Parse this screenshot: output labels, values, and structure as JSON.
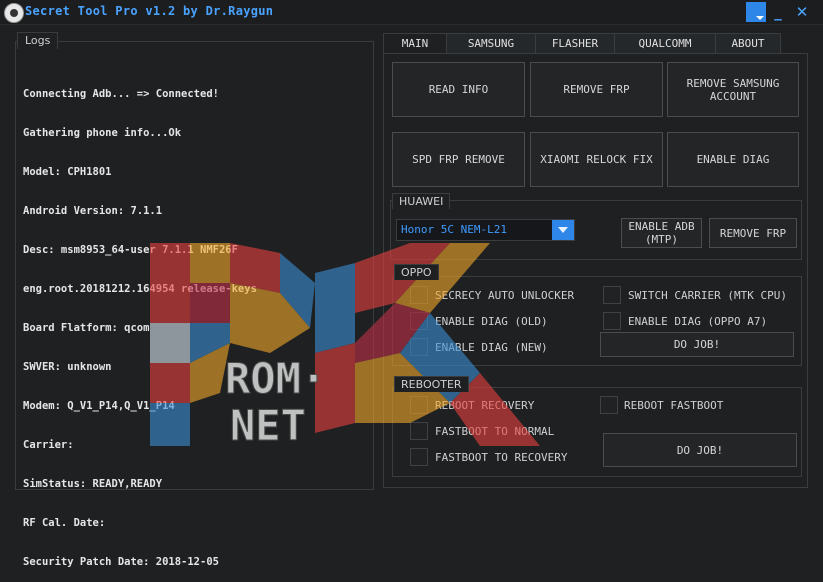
{
  "window": {
    "title": "Secret Tool Pro v1.2 by Dr.Raygun",
    "menu_icon": "dropdown-menu-icon",
    "minimize_label": "_",
    "close_label": "✕"
  },
  "logs": {
    "label": "Logs",
    "lines": [
      "Connecting Adb... => Connected!",
      "Gathering phone info...Ok",
      "Model: CPH1801",
      "Android Version: 7.1.1",
      "Desc: msm8953_64-user 7.1.1 NMF26F",
      "eng.root.20181212.164954 release-keys",
      "Board Flatform: qcom",
      "SWVER: unknown",
      "Modem: Q_V1_P14,Q_V1_P14",
      "Carrier:",
      "SimStatus: READY,READY",
      "RF Cal. Date:",
      "Security Patch Date: 2018-12-05"
    ]
  },
  "tabs": [
    "MAIN",
    "SAMSUNG",
    "FLASHER",
    "QUALCOMM",
    "ABOUT"
  ],
  "main": {
    "read_info": "READ INFO",
    "remove_frp": "REMOVE FRP",
    "remove_samsung_account": [
      "REMOVE SAMSUNG",
      "ACCOUNT"
    ],
    "spd_frp_remove": "SPD FRP REMOVE",
    "xiaomi_relock_fix": "XIAOMI RELOCK FIX",
    "enable_diag": "ENABLE DIAG"
  },
  "huawei": {
    "label": "HUAWEI",
    "model_selected": "Honor 5C NEM-L21",
    "enable_adb": [
      "ENABLE ADB",
      "(MTP)"
    ],
    "remove_frp": "REMOVE FRP"
  },
  "oppo": {
    "label": "OPPO",
    "secrecy_auto_unlocker": "SECRECY AUTO UNLOCKER",
    "switch_carrier": "SWITCH CARRIER (MTK CPU)",
    "enable_diag_old": "ENABLE DIAG (OLD)",
    "enable_diag_oppo_a7": "ENABLE DIAG (OPPO A7)",
    "enable_diag_new": "ENABLE DIAG (NEW)",
    "do_job": "DO JOB!"
  },
  "rebooter": {
    "label": "REBOOTER",
    "reboot_recovery": "REBOOT RECOVERY",
    "reboot_fastboot": "REBOOT FASTBOOT",
    "fastboot_to_normal": "FASTBOOT TO NORMAL",
    "fastboot_to_recovery": "FASTBOOT TO RECOVERY",
    "do_job": "DO JOB!"
  },
  "watermark": {
    "line1": "ROM·",
    "line2": "NET"
  },
  "colors": {
    "accent": "#2e86e8",
    "title": "#4aa3ff",
    "background": "#1e2022"
  }
}
